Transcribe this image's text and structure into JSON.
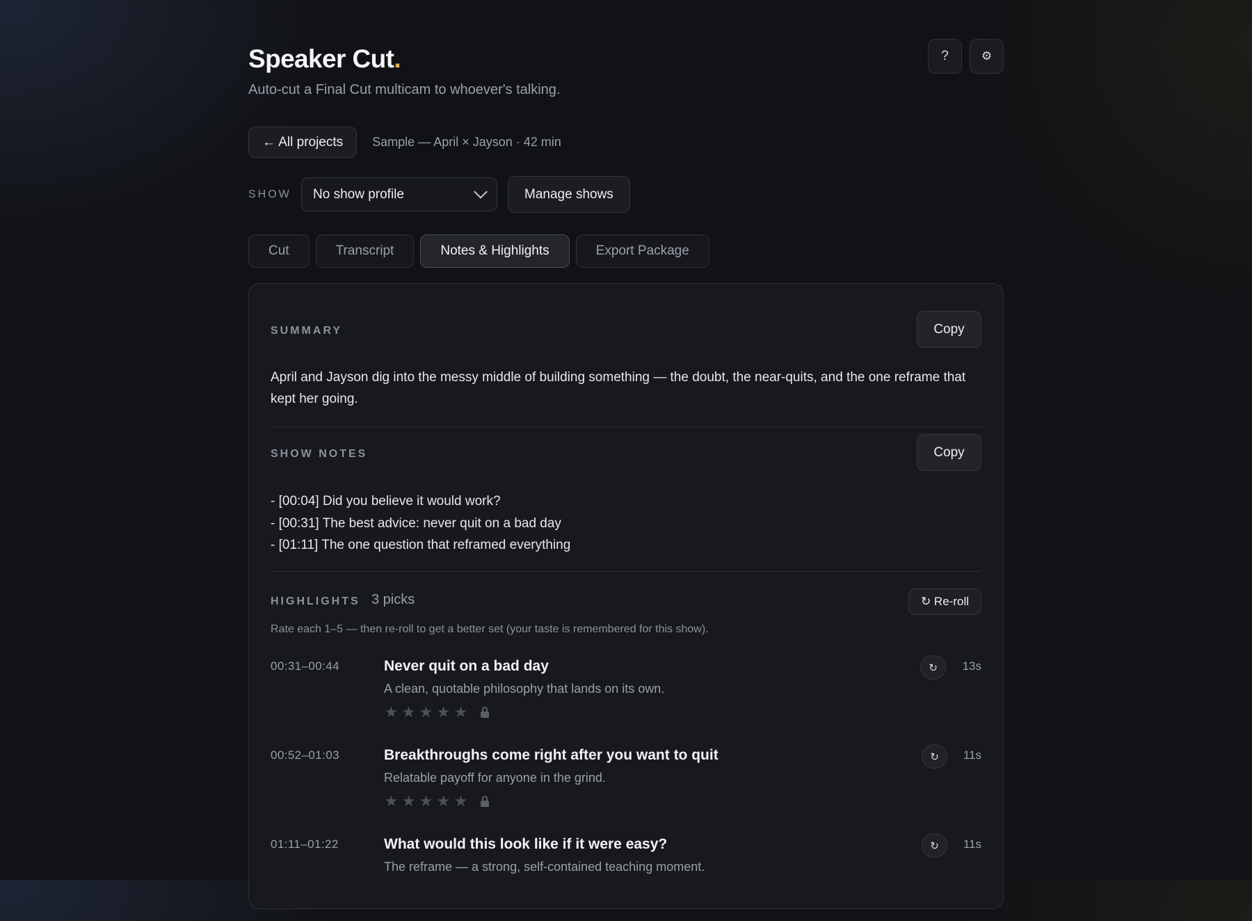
{
  "app": {
    "title": "Speaker Cut",
    "title_dot": ".",
    "subtitle": "Auto-cut a Final Cut multicam to whoever's talking.",
    "help_label": "?",
    "settings_icon": "gear-icon",
    "accent_color": "#e6b64a"
  },
  "project": {
    "back_label": "← All projects",
    "meta": "Sample — April × Jayson · 42 min"
  },
  "show": {
    "label": "SHOW",
    "selected": "No show profile",
    "manage_label": "Manage shows"
  },
  "tabs": [
    {
      "label": "Cut",
      "active": false
    },
    {
      "label": "Transcript",
      "active": false
    },
    {
      "label": "Notes & Highlights",
      "active": true
    },
    {
      "label": "Export Package",
      "active": false
    }
  ],
  "summary": {
    "label": "SUMMARY",
    "copy_label": "Copy",
    "text": "April and Jayson dig into the messy middle of building something — the doubt, the near-quits, and the one reframe that kept her going."
  },
  "show_notes": {
    "label": "SHOW NOTES",
    "copy_label": "Copy",
    "lines": [
      "- [00:04] Did you believe it would work?",
      "- [00:31] The best advice: never quit on a bad day",
      "- [01:11] The one question that reframed everything"
    ]
  },
  "highlights": {
    "label": "HIGHLIGHTS",
    "count": "3 picks",
    "reroll_label": "↻ Re-roll",
    "hint": "Rate each 1–5 — then re-roll to get a better set (your taste is remembered for this show).",
    "items": [
      {
        "time": "00:31–00:44",
        "title": "Never quit on a bad day",
        "desc": "A clean, quotable philosophy that lands on its own.",
        "duration": "13s",
        "rating": 0,
        "redo": "↻"
      },
      {
        "time": "00:52–01:03",
        "title": "Breakthroughs come right after you want to quit",
        "desc": "Relatable payoff for anyone in the grind.",
        "duration": "11s",
        "rating": 0,
        "redo": "↻"
      },
      {
        "time": "01:11–01:22",
        "title": "What would this look like if it were easy?",
        "desc": "The reframe — a strong, self-contained teaching moment.",
        "duration": "11s",
        "rating": 0,
        "redo": "↻"
      }
    ],
    "star_glyph": "★"
  }
}
